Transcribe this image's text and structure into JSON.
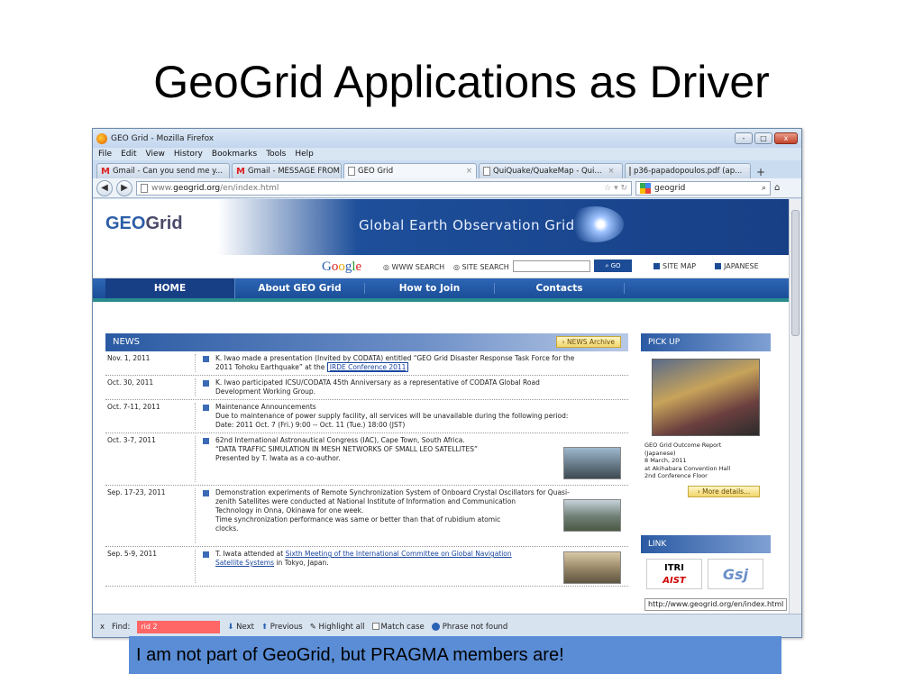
{
  "slide": {
    "title": "GeoGrid Applications as Driver",
    "caption": "I am not part of GeoGrid, but PRAGMA members are!"
  },
  "window": {
    "title": "GEO Grid - Mozilla Firefox",
    "controls": [
      "-",
      "□",
      "x"
    ]
  },
  "menubar": [
    "File",
    "Edit",
    "View",
    "History",
    "Bookmarks",
    "Tools",
    "Help"
  ],
  "tabs": [
    {
      "label": "Gmail - Can you send me y...",
      "icon": "gmail-icon"
    },
    {
      "label": "Gmail - MESSAGE FROM US...",
      "icon": "gmail-icon"
    },
    {
      "label": "GEO Grid",
      "icon": "page-icon",
      "active": true
    },
    {
      "label": "QuiQuake/QuakeMap - Qui...",
      "icon": "page-icon"
    },
    {
      "label": "p36-papadopoulos.pdf (ap...",
      "icon": "page-icon"
    }
  ],
  "nav": {
    "url_prefix": "www.",
    "url_domain": "geogrid.org",
    "url_path": "/en/index.html",
    "search_value": "geogrid"
  },
  "site": {
    "logo_geo": "GEO",
    "logo_grid": "Grid",
    "banner_title": "Global Earth Observation Grid",
    "google_search": {
      "www_search": "WWW SEARCH",
      "site_search": "SITE SEARCH",
      "go": "GO",
      "site_map": "SITE MAP",
      "japanese": "JAPANESE"
    },
    "menu": [
      "HOME",
      "About GEO Grid",
      "How to Join",
      "Contacts"
    ],
    "news": {
      "title": "NEWS",
      "archive": "NEWS Archive",
      "items": [
        {
          "date": "Nov. 1, 2011",
          "line1": "K. Iwao made a presentation (Invited by CODATA) entitled “GEO Grid Disaster Response Task Force for the",
          "line2_pre": "2011 Tohoku Earthquake” at the ",
          "line2_link": "IRDE Conference 2011"
        },
        {
          "date": "Oct. 30, 2011",
          "line1": "K. Iwao participated ICSU/CODATA 45th Anniversary as a representative of CODATA Global Road",
          "line2": "Development Working Group."
        },
        {
          "date": "Oct. 7-11, 2011",
          "line1": "Maintenance Announcements",
          "line2": "Due to maintenance of power supply facility, all services will be unavailable during the following period:",
          "line3": "Date: 2011 Oct. 7 (Fri.) 9:00 -- Oct. 11 (Tue.) 18:00 (JST)"
        },
        {
          "date": "Oct. 3-7, 2011",
          "line1": "62nd International Astronautical Congress (IAC), Cape Town, South Africa.",
          "line2": "“DATA TRAFFIC SIMULATION IN MESH NETWORKS OF SMALL LEO SATELLITES”",
          "line3": "Presented by T. Iwata as a co-author."
        },
        {
          "date": "Sep. 17-23, 2011",
          "line1": "Demonstration experiments of Remote Synchronization System of Onboard Crystal Oscillators for Quasi-",
          "line2": "zenith Satellites were conducted at National Institute of Information and Communication",
          "line3": "Technology in Onna, Okinawa for one week.",
          "line4": "Time synchronization performance was same or better than that of rubidium atomic",
          "line5": "clocks."
        },
        {
          "date": "Sep. 5-9, 2011",
          "line1_pre": "T. Iwata attended at ",
          "line1_link": "Sixth Meeting of the International Committee on Global Navigation",
          "line2_link": "Satellite Systems",
          "line2_post": " in Tokyo, Japan."
        }
      ]
    },
    "pickup": {
      "title": "PICK UP",
      "text1": "GEO Grid Outcome Report",
      "text2": "(Japanese)",
      "text3": "8 March, 2011",
      "text4": "at Akihabara Convention Hall",
      "text5": "2nd Conference Floor",
      "more": "More details..."
    },
    "links": {
      "title": "LINK",
      "itri_top": "ITRI",
      "itri_bottom": "AIST"
    },
    "status_url": "http://www.geogrid.org/en/index.html"
  },
  "findbar": {
    "close": "x",
    "label": "Find:",
    "value": "rid 2",
    "next": "Next",
    "previous": "Previous",
    "highlight": "Highlight all",
    "match_case": "Match case",
    "status": "Phrase not found"
  }
}
